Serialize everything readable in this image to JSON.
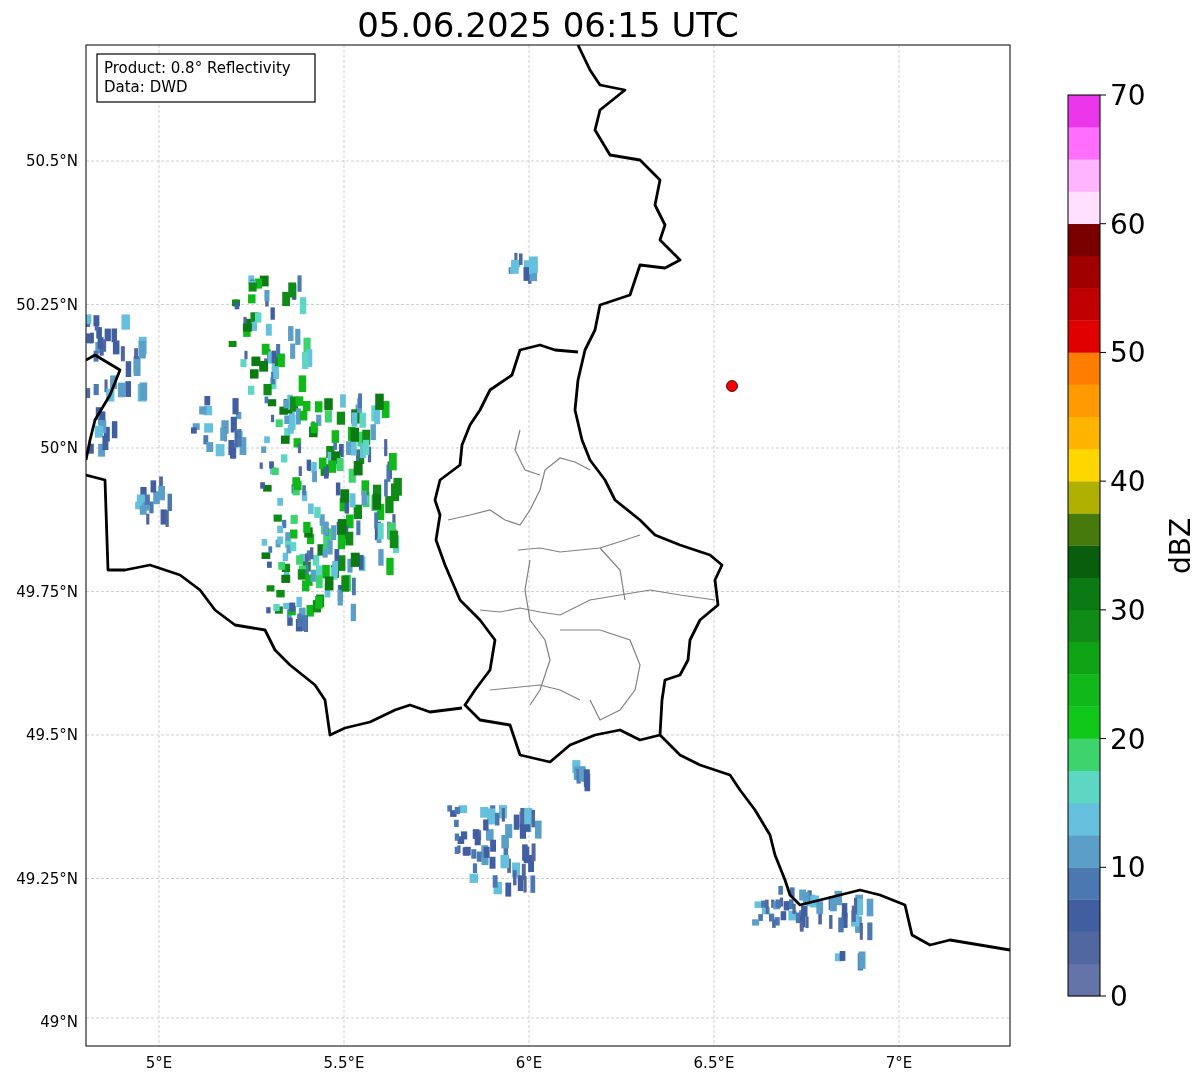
{
  "title": "05.06.2025 06:15 UTC",
  "info_box": {
    "lines": [
      "Product: 0.8° Reflectivity",
      "Data: DWD"
    ]
  },
  "map": {
    "lat_labels": [
      "50.5°N",
      "50.25°N",
      "50°N",
      "49.75°N",
      "49.5°N",
      "49.25°N",
      "49°N"
    ],
    "lon_labels": [
      "5°E",
      "5.5°E",
      "6°E",
      "6.5°E",
      "7°E"
    ]
  },
  "colorbar": {
    "label": "dBZ",
    "ticks": [
      "70",
      "60",
      "50",
      "40",
      "30",
      "20",
      "10",
      "0"
    ],
    "bins": [
      {
        "color": "#6474a8"
      },
      {
        "color": "#51679f"
      },
      {
        "color": "#405ea0"
      },
      {
        "color": "#4b78b0"
      },
      {
        "color": "#5b9ec8"
      },
      {
        "color": "#64c0dc"
      },
      {
        "color": "#5dd6c4"
      },
      {
        "color": "#3dd46e"
      },
      {
        "color": "#10c81a"
      },
      {
        "color": "#10b81a"
      },
      {
        "color": "#0fa416"
      },
      {
        "color": "#0f8c16"
      },
      {
        "color": "#0b7a12"
      },
      {
        "color": "#085e0c"
      },
      {
        "color": "#467a0c"
      },
      {
        "color": "#b0b000"
      },
      {
        "color": "#ffd700"
      },
      {
        "color": "#ffb400"
      },
      {
        "color": "#ff9a00"
      },
      {
        "color": "#ff7d00"
      },
      {
        "color": "#e10000"
      },
      {
        "color": "#c00000"
      },
      {
        "color": "#a00000"
      },
      {
        "color": "#7a0000"
      },
      {
        "color": "#ffe0ff"
      },
      {
        "color": "#ffb4ff"
      },
      {
        "color": "#ff6eff"
      },
      {
        "color": "#eb36eb"
      }
    ]
  }
}
